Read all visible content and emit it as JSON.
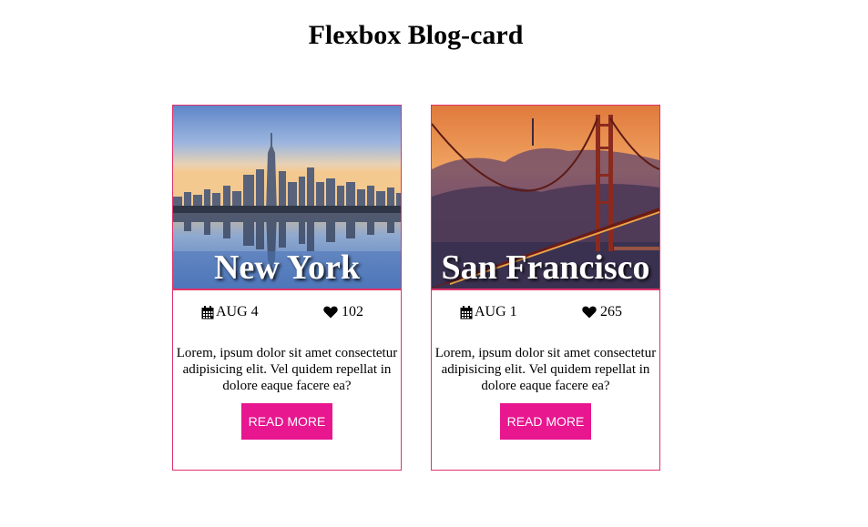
{
  "page": {
    "title": "Flexbox Blog-card"
  },
  "colors": {
    "card_border": "#e0336a",
    "button_bg": "#e8168f",
    "button_text": "#ffffff"
  },
  "cards": [
    {
      "city": "New York",
      "image_icon": "new-york-skyline-image",
      "date_icon": "calendar-icon",
      "date": "AUG 4",
      "likes_icon": "heart-icon",
      "likes": "102",
      "text": "Lorem, ipsum dolor sit amet consectetur adipisicing elit. Vel quidem repellat in dolore eaque facere ea?",
      "button_label": "READ MORE"
    },
    {
      "city": "San Francisco",
      "image_icon": "golden-gate-bridge-image",
      "date_icon": "calendar-icon",
      "date": "AUG 1",
      "likes_icon": "heart-icon",
      "likes": "265",
      "text": "Lorem, ipsum dolor sit amet consectetur adipisicing elit. Vel quidem repellat in dolore eaque facere ea?",
      "button_label": "READ MORE"
    }
  ]
}
